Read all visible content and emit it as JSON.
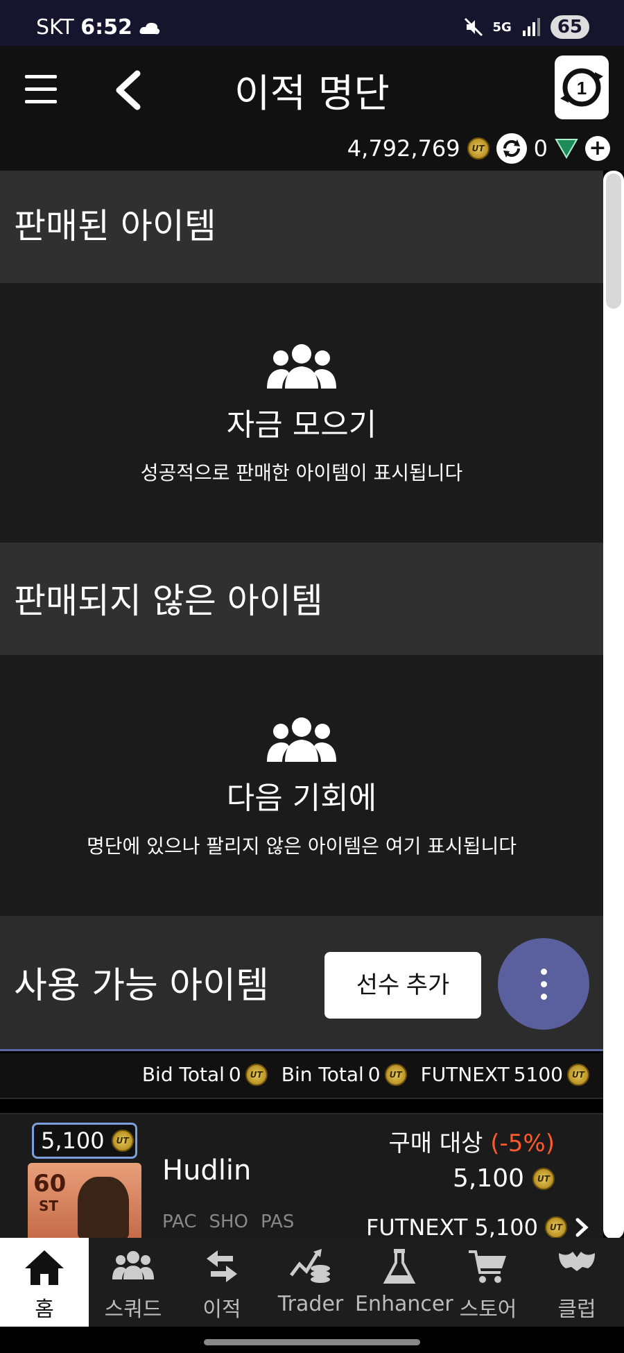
{
  "status_bar": {
    "carrier": "SKT",
    "time": "6:52",
    "network": "5G",
    "battery": "65"
  },
  "header": {
    "title": "이적 명단",
    "coins": "4,792,769",
    "points": "0"
  },
  "sold_section": {
    "title": "판매된 아이템",
    "empty_title": "자금 모으기",
    "empty_desc": "성공적으로 판매한 아이템이 표시됩니다"
  },
  "unsold_section": {
    "title": "판매되지 않은 아이템",
    "empty_title": "다음 기회에",
    "empty_desc": "명단에 있으나 팔리지 않은 아이템은 여기 표시됩니다"
  },
  "available_section": {
    "title": "사용 가능 아이템",
    "add_player_label": "선수 추가"
  },
  "totals": {
    "bid_label": "Bid Total",
    "bid_value": "0",
    "bin_label": "Bin Total",
    "bin_value": "0",
    "futnext_label": "FUTNEXT",
    "futnext_value": "5100"
  },
  "item": {
    "price_tag": "5,100",
    "rating": "60",
    "position": "ST",
    "name": "Hudlin",
    "stats": [
      "PAC",
      "SHO",
      "PAS"
    ],
    "buy_label": "구매 대상",
    "buy_pct": "(-5%)",
    "buy_price": "5,100",
    "futnext_label": "FUTNEXT",
    "futnext_price": "5,100"
  },
  "coin_icon_text": "UT",
  "nav": [
    {
      "label": "홈",
      "icon": "home-icon"
    },
    {
      "label": "스쿼드",
      "icon": "squad-icon"
    },
    {
      "label": "이적",
      "icon": "transfer-icon"
    },
    {
      "label": "Trader",
      "icon": "trader-icon"
    },
    {
      "label": "Enhancer",
      "icon": "enhancer-icon"
    },
    {
      "label": "스토어",
      "icon": "store-icon"
    },
    {
      "label": "클럽",
      "icon": "club-icon"
    }
  ],
  "colors": {
    "accent": "#5a5f9e",
    "discount": "#ff5a2a",
    "coin": "#e8c95a"
  }
}
